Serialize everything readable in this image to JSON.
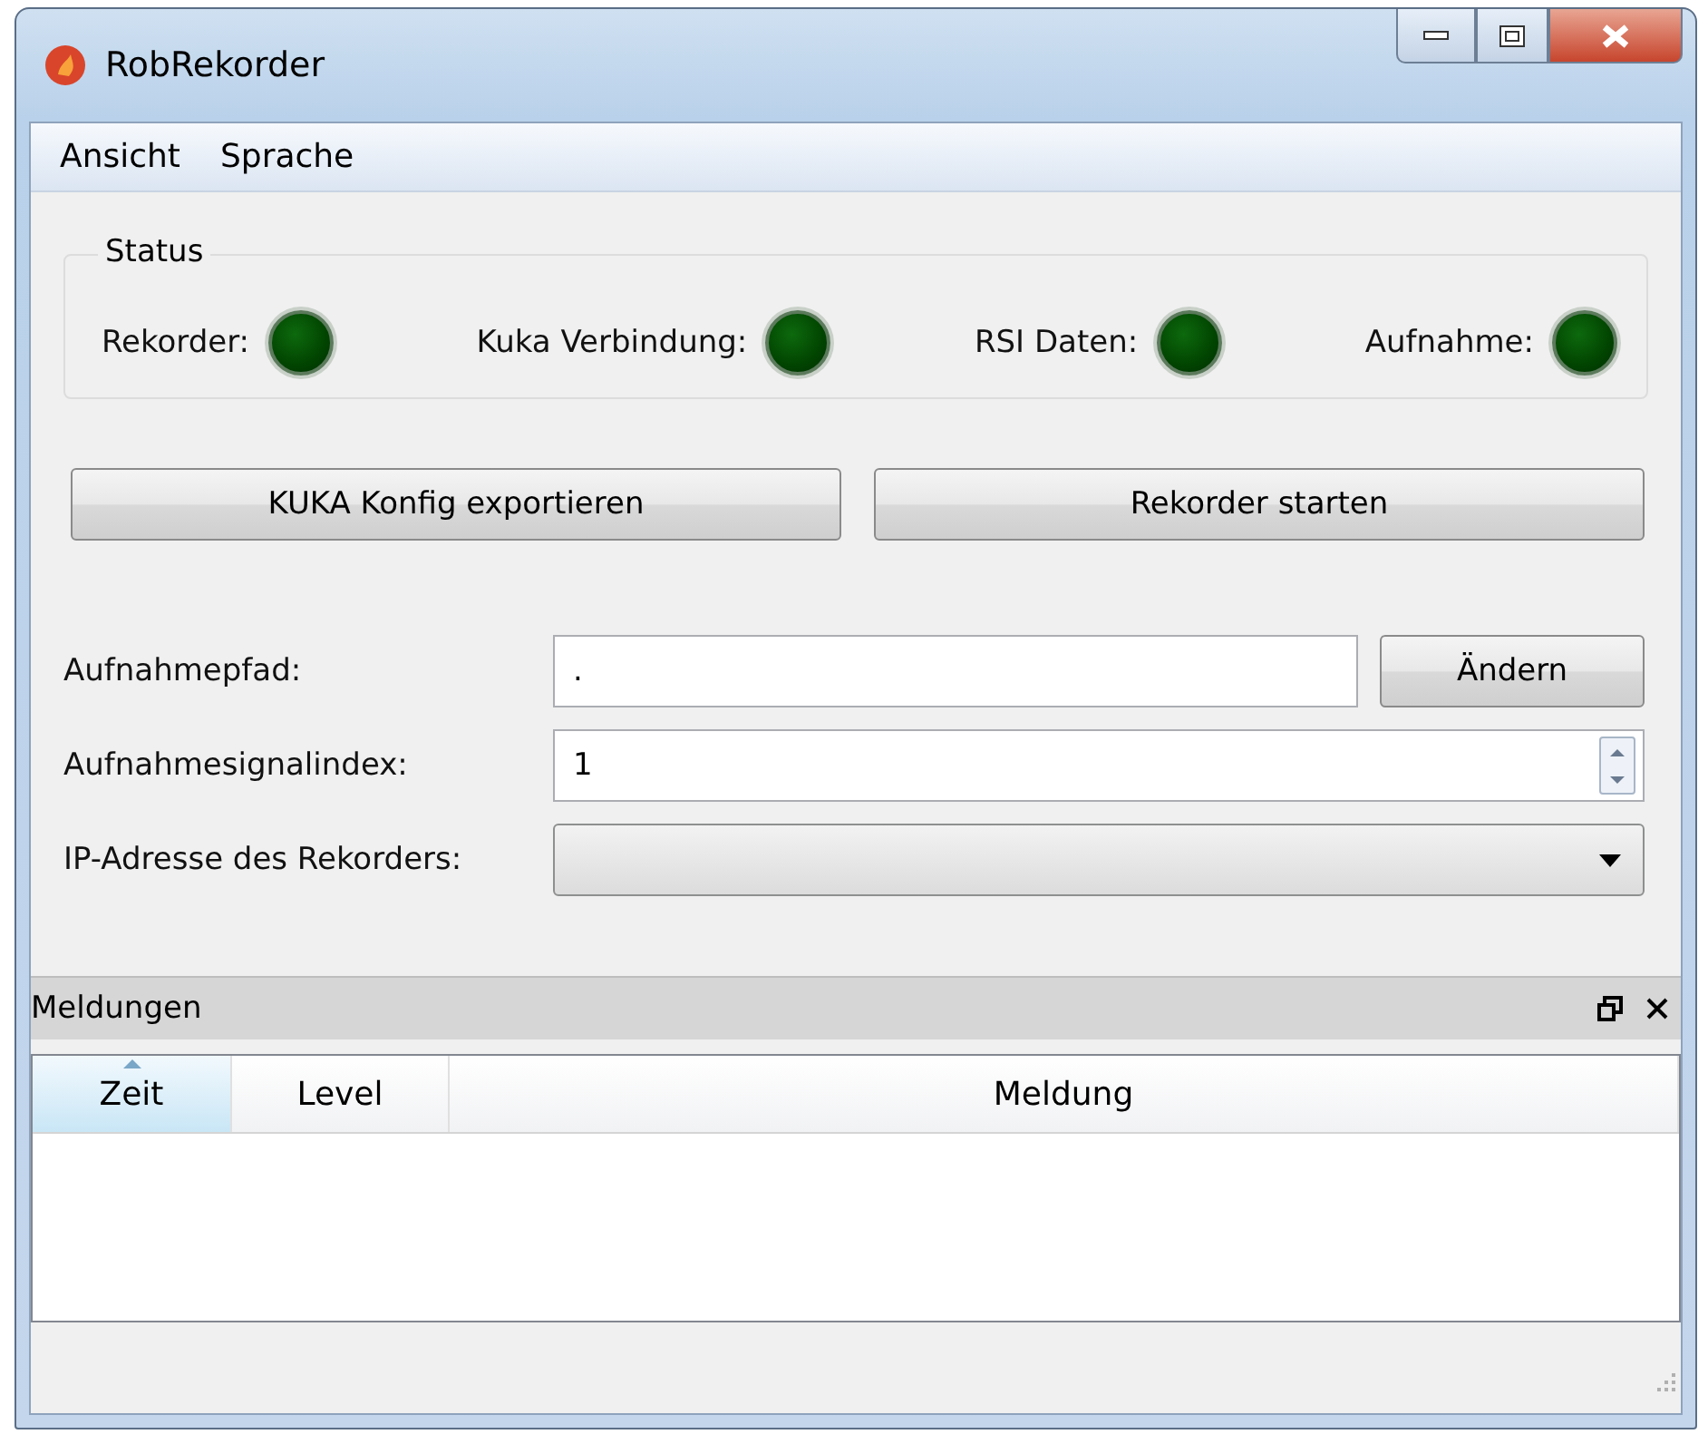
{
  "window": {
    "title": "RobRekorder"
  },
  "menu": [
    "Ansicht",
    "Sprache"
  ],
  "status": {
    "title": "Status",
    "indicators": [
      {
        "label": "Rekorder:",
        "on": false
      },
      {
        "label": "Kuka Verbindung:",
        "on": false
      },
      {
        "label": "RSI Daten:",
        "on": false
      },
      {
        "label": "Aufnahme:",
        "on": false
      }
    ]
  },
  "actions": [
    "KUKA Konfig exportieren",
    "Rekorder starten"
  ],
  "form": [
    {
      "kind": "path",
      "label": "Aufnahmepfad:",
      "value": ".",
      "button": "Ändern"
    },
    {
      "kind": "spin",
      "label": "Aufnahmesignalindex:",
      "value": "1"
    },
    {
      "kind": "combo",
      "label": "IP-Adresse des Rekorders:"
    }
  ],
  "dock": {
    "title": "Meldungen",
    "columns": [
      {
        "label": "Zeit",
        "sorted": true
      },
      {
        "label": "Level",
        "sorted": false
      },
      {
        "label": "Meldung",
        "sorted": false
      }
    ]
  }
}
